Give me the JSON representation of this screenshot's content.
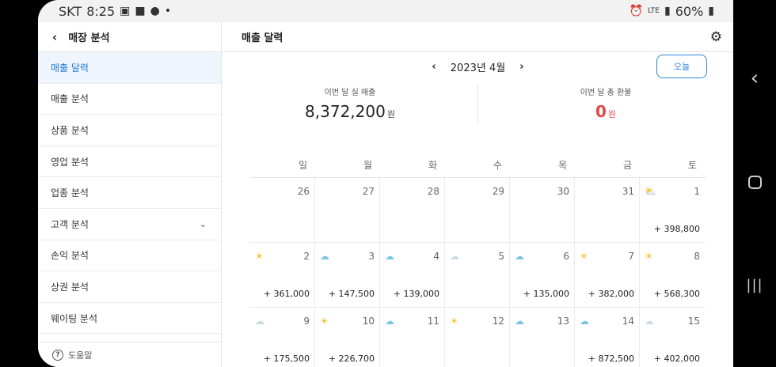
{
  "status_bar": {
    "carrier": "SKT",
    "time": "8:25",
    "battery": "60%",
    "network": "LTE"
  },
  "sidebar": {
    "title": "매장 분석",
    "items": [
      {
        "label": "매출 달력",
        "active": true
      },
      {
        "label": "매출 분석"
      },
      {
        "label": "상품 분석"
      },
      {
        "label": "영업 분석"
      },
      {
        "label": "업종 분석"
      },
      {
        "label": "고객 분석",
        "expandable": true
      },
      {
        "label": "손익 분석"
      },
      {
        "label": "상권 분석"
      },
      {
        "label": "웨이팅 분석"
      }
    ],
    "help_label": "도움말"
  },
  "main": {
    "title": "매출 달력",
    "month_label": "2023년 4월",
    "today_label": "오늘",
    "summary": {
      "sales_label": "이번 달 실 매출",
      "sales_value": "8,372,200",
      "sales_unit": "원",
      "refund_label": "이번 달 총 환불",
      "refund_value": "0",
      "refund_unit": "원"
    },
    "weekdays": [
      "일",
      "월",
      "화",
      "수",
      "목",
      "금",
      "토"
    ],
    "weeks": [
      [
        {
          "day": "26"
        },
        {
          "day": "27"
        },
        {
          "day": "28"
        },
        {
          "day": "29"
        },
        {
          "day": "30"
        },
        {
          "day": "31"
        },
        {
          "day": "1",
          "weather": "partly-cloudy",
          "amount": "+ 398,800"
        }
      ],
      [
        {
          "day": "2",
          "weather": "sun",
          "amount": "+ 361,000"
        },
        {
          "day": "3",
          "weather": "cloud",
          "amount": "+ 147,500"
        },
        {
          "day": "4",
          "weather": "cloud",
          "amount": "+ 139,000"
        },
        {
          "day": "5",
          "weather": "cloud-light",
          "amount": ""
        },
        {
          "day": "6",
          "weather": "cloud",
          "amount": "+ 135,000"
        },
        {
          "day": "7",
          "weather": "sun",
          "amount": "+ 382,000"
        },
        {
          "day": "8",
          "weather": "sun",
          "amount": "+ 568,300"
        }
      ],
      [
        {
          "day": "9",
          "weather": "cloud-light",
          "amount": "+ 175,500"
        },
        {
          "day": "10",
          "weather": "sun",
          "amount": "+ 226,700"
        },
        {
          "day": "11",
          "weather": "cloud",
          "amount": ""
        },
        {
          "day": "12",
          "weather": "sun",
          "amount": ""
        },
        {
          "day": "13",
          "weather": "cloud",
          "amount": ""
        },
        {
          "day": "14",
          "weather": "cloud",
          "amount": "+ 872,500"
        },
        {
          "day": "15",
          "weather": "cloud-light",
          "amount": "+ 402,000"
        }
      ]
    ]
  },
  "icons": {
    "back": "chevron-left-icon",
    "settings": "gear-icon",
    "help": "help-circle-icon"
  },
  "colors": {
    "accent": "#2d86d8",
    "active_bg": "#eef5fc",
    "refund": "#e04848",
    "sun": "#f3bb1c",
    "cloud": "#7cc3e6"
  }
}
